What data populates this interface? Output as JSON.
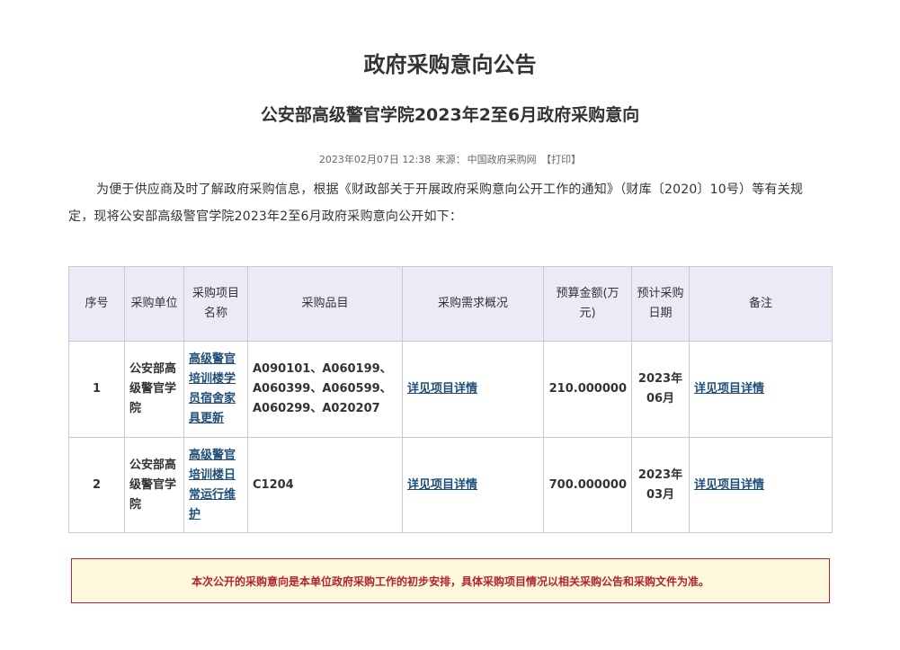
{
  "title": "政府采购意向公告",
  "subtitle": "公安部高级警官学院2023年2至6月政府采购意向",
  "meta": {
    "datetime": "2023年02月07日 12:38",
    "source_label": "来源：",
    "source": "中国政府采购网",
    "print_label": "【打印】"
  },
  "intro": "为便于供应商及时了解政府采购信息，根据《财政部关于开展政府采购意向公开工作的通知》（财库〔2020〕10号）等有关规定，现将公安部高级警官学院2023年2至6月政府采购意向公开如下：",
  "table": {
    "headers": {
      "seq": "序号",
      "unit": "采购单位",
      "project": "采购项目名称",
      "items": "采购品目",
      "requirement": "采购需求概况",
      "budget": "预算金额(万元)",
      "date": "预计采购日期",
      "remark": "备注"
    },
    "rows": [
      {
        "seq": "1",
        "unit": "公安部高级警官学院",
        "project": "高级警官培训楼学员宿舍家具更新",
        "items": "A090101、A060199、A060399、A060599、A060299、A020207",
        "requirement": "详见项目详情",
        "budget": "210.000000",
        "date": "2023年06月",
        "remark": "详见项目详情"
      },
      {
        "seq": "2",
        "unit": "公安部高级警官学院",
        "project": "高级警官培训楼日常运行维护",
        "items": "C1204",
        "requirement": "详见项目详情",
        "budget": "700.000000",
        "date": "2023年03月",
        "remark": "详见项目详情"
      }
    ]
  },
  "notice": "本次公开的采购意向是本单位政府采购工作的初步安排，具体采购项目情况以相关采购公告和采购文件为准。",
  "colors": {
    "header_bg": "#ebebf7",
    "link": "#1f4e79",
    "notice_bg": "#fdf7dc",
    "notice_border": "#c81d3c",
    "notice_text": "#b3242b"
  }
}
